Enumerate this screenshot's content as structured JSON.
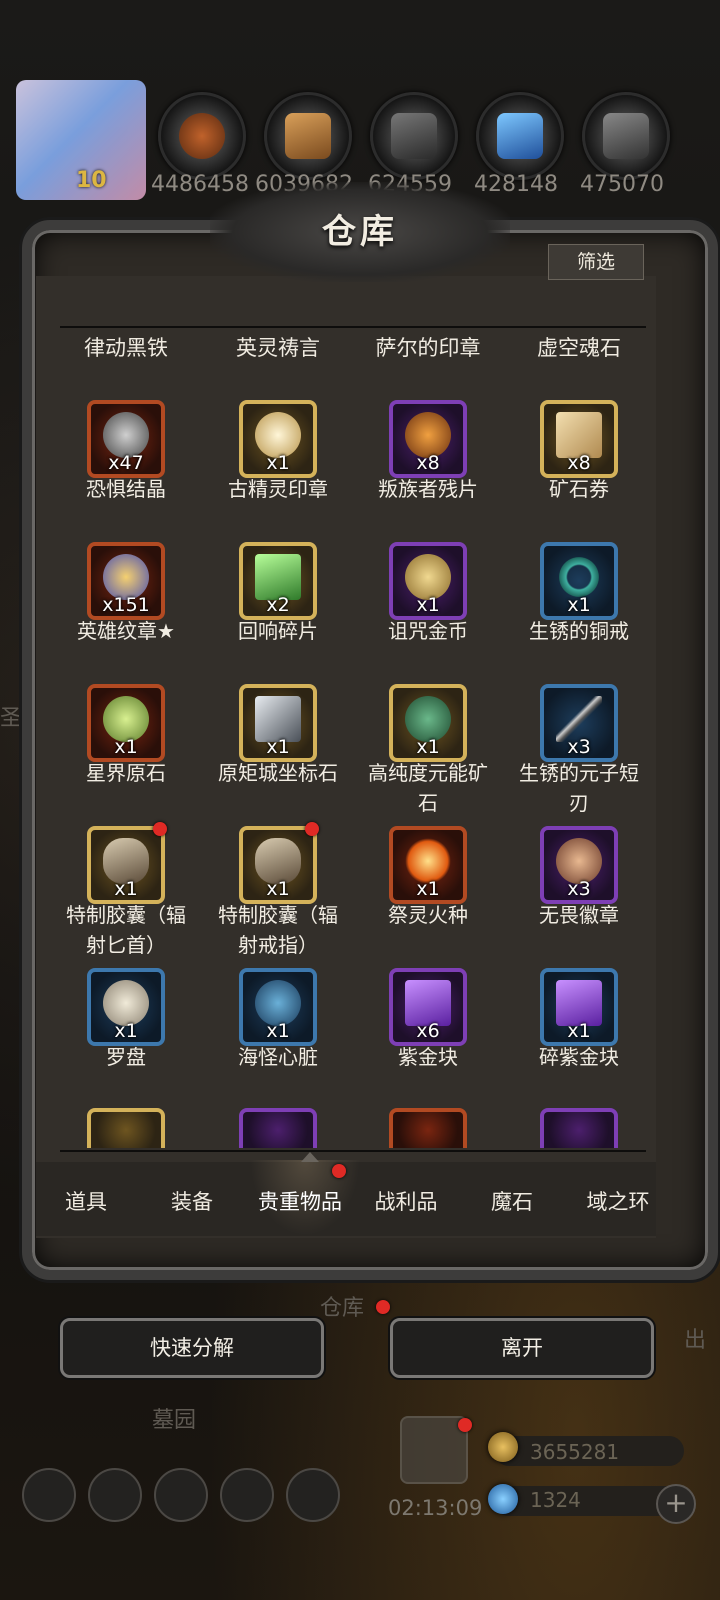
{
  "resources": {
    "level": "10",
    "values": [
      "4486458",
      "6039682",
      "624559",
      "428148",
      "475070"
    ]
  },
  "panel": {
    "title": "仓库",
    "filter_label": "筛选"
  },
  "top_row_names": [
    "律动黑铁",
    "英灵祷言",
    "萨尔的印章",
    "虚空魂石"
  ],
  "items": [
    {
      "qty": "x47",
      "name": "恐惧结晶",
      "rarity": "orange"
    },
    {
      "qty": "x1",
      "name": "古精灵印章",
      "rarity": "gold"
    },
    {
      "qty": "x8",
      "name": "叛族者残片",
      "rarity": "purple"
    },
    {
      "qty": "x8",
      "name": "矿石券",
      "rarity": "gold"
    },
    {
      "qty": "x151",
      "name": "英雄纹章★",
      "rarity": "orange"
    },
    {
      "qty": "x2",
      "name": "回响碎片",
      "rarity": "gold"
    },
    {
      "qty": "x1",
      "name": "诅咒金币",
      "rarity": "purple"
    },
    {
      "qty": "x1",
      "name": "生锈的铜戒",
      "rarity": "blue"
    },
    {
      "qty": "x1",
      "name": "星界原石",
      "rarity": "orange"
    },
    {
      "qty": "x1",
      "name": "原矩城坐标石",
      "rarity": "gold"
    },
    {
      "qty": "x1",
      "name_line1": "高纯度元能矿",
      "name_line2": "石",
      "rarity": "gold"
    },
    {
      "qty": "x3",
      "name_line1": "生锈的元子短",
      "name_line2": "刃",
      "rarity": "blue"
    },
    {
      "qty": "x1",
      "name_line1": "特制胶囊（辐",
      "name_line2": "射匕首）",
      "rarity": "gold",
      "badge": true
    },
    {
      "qty": "x1",
      "name_line1": "特制胶囊（辐",
      "name_line2": "射戒指）",
      "rarity": "gold",
      "badge": true
    },
    {
      "qty": "x1",
      "name": "祭灵火种",
      "rarity": "orange"
    },
    {
      "qty": "x3",
      "name": "无畏徽章",
      "rarity": "purple"
    },
    {
      "qty": "x1",
      "name": "罗盘",
      "rarity": "blue"
    },
    {
      "qty": "x1",
      "name": "海怪心脏",
      "rarity": "blue"
    },
    {
      "qty": "x6",
      "name": "紫金块",
      "rarity": "purple"
    },
    {
      "qty": "x1",
      "name": "碎紫金块",
      "rarity": "blue"
    }
  ],
  "tabs": [
    "道具",
    "装备",
    "贵重物品",
    "战利品",
    "魔石",
    "域之环"
  ],
  "active_tab": "贵重物品",
  "buttons": {
    "decompose": "快速分解",
    "leave": "离开"
  },
  "background": {
    "warehouse_label": "仓库",
    "cemetery_label": "墓园",
    "side_label": "圣",
    "right_label": "出",
    "gold_amount": "3655281",
    "gem_amount": "1324",
    "timer": "02:13:09",
    "plus_label": "+"
  },
  "colors": {
    "gold_border": "#d4b25a",
    "purple_border": "#7e3fb5",
    "orange_border": "#b24a22",
    "blue_border": "#3d78ad",
    "badge": "#e02a25"
  }
}
